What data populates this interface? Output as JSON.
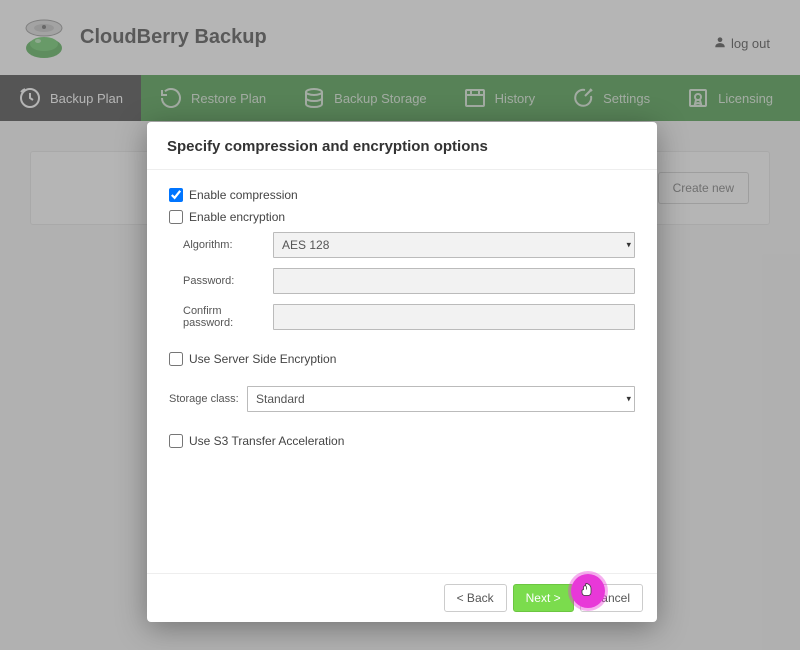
{
  "header": {
    "app_title": "CloudBerry Backup",
    "logout_label": "log out"
  },
  "nav": {
    "items": [
      {
        "label": "Backup Plan",
        "icon": "clock-icon"
      },
      {
        "label": "Restore Plan",
        "icon": "restore-icon"
      },
      {
        "label": "Backup Storage",
        "icon": "storage-icon"
      },
      {
        "label": "History",
        "icon": "history-icon"
      },
      {
        "label": "Settings",
        "icon": "settings-icon"
      },
      {
        "label": "Licensing",
        "icon": "licensing-icon"
      }
    ]
  },
  "page": {
    "create_new_label": "Create new"
  },
  "modal": {
    "title": "Specify compression and encryption options",
    "compression": {
      "label": "Enable compression",
      "checked": true
    },
    "encryption": {
      "label": "Enable encryption",
      "checked": false
    },
    "algorithm": {
      "label": "Algorithm:",
      "value": "AES 128"
    },
    "password": {
      "label": "Password:",
      "value": ""
    },
    "confirm_password": {
      "label": "Confirm password:",
      "value": ""
    },
    "server_side": {
      "label": "Use Server Side Encryption",
      "checked": false
    },
    "storage_class": {
      "label": "Storage class:",
      "value": "Standard"
    },
    "s3accel": {
      "label": "Use S3 Transfer Acceleration",
      "checked": false
    },
    "buttons": {
      "back": "< Back",
      "next": "Next >",
      "cancel": "Cancel"
    }
  },
  "colors": {
    "nav_green": "#2f8f2f",
    "accent_green": "#7bdc4d"
  }
}
